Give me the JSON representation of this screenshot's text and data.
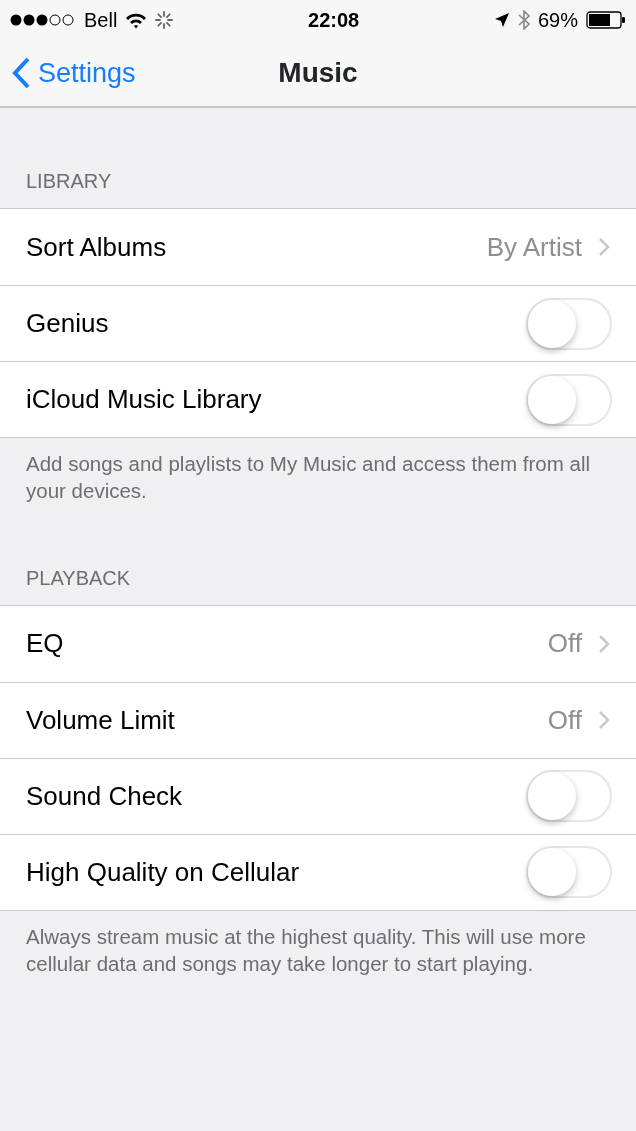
{
  "status_bar": {
    "carrier": "Bell",
    "time": "22:08",
    "battery": "69%"
  },
  "nav": {
    "back": "Settings",
    "title": "Music"
  },
  "sections": [
    {
      "header": "LIBRARY",
      "rows": [
        {
          "kind": "value",
          "label": "Sort Albums",
          "value": "By Artist"
        },
        {
          "kind": "toggle",
          "label": "Genius",
          "on": false
        },
        {
          "kind": "toggle",
          "label": "iCloud Music Library",
          "on": false
        }
      ],
      "footer": "Add songs and playlists to My Music and access them from all your devices."
    },
    {
      "header": "PLAYBACK",
      "rows": [
        {
          "kind": "value",
          "label": "EQ",
          "value": "Off"
        },
        {
          "kind": "value",
          "label": "Volume Limit",
          "value": "Off"
        },
        {
          "kind": "toggle",
          "label": "Sound Check",
          "on": false
        },
        {
          "kind": "toggle",
          "label": "High Quality on Cellular",
          "on": false
        }
      ],
      "footer": "Always stream music at the highest quality. This will use more cellular data and songs may take longer to start playing."
    }
  ]
}
